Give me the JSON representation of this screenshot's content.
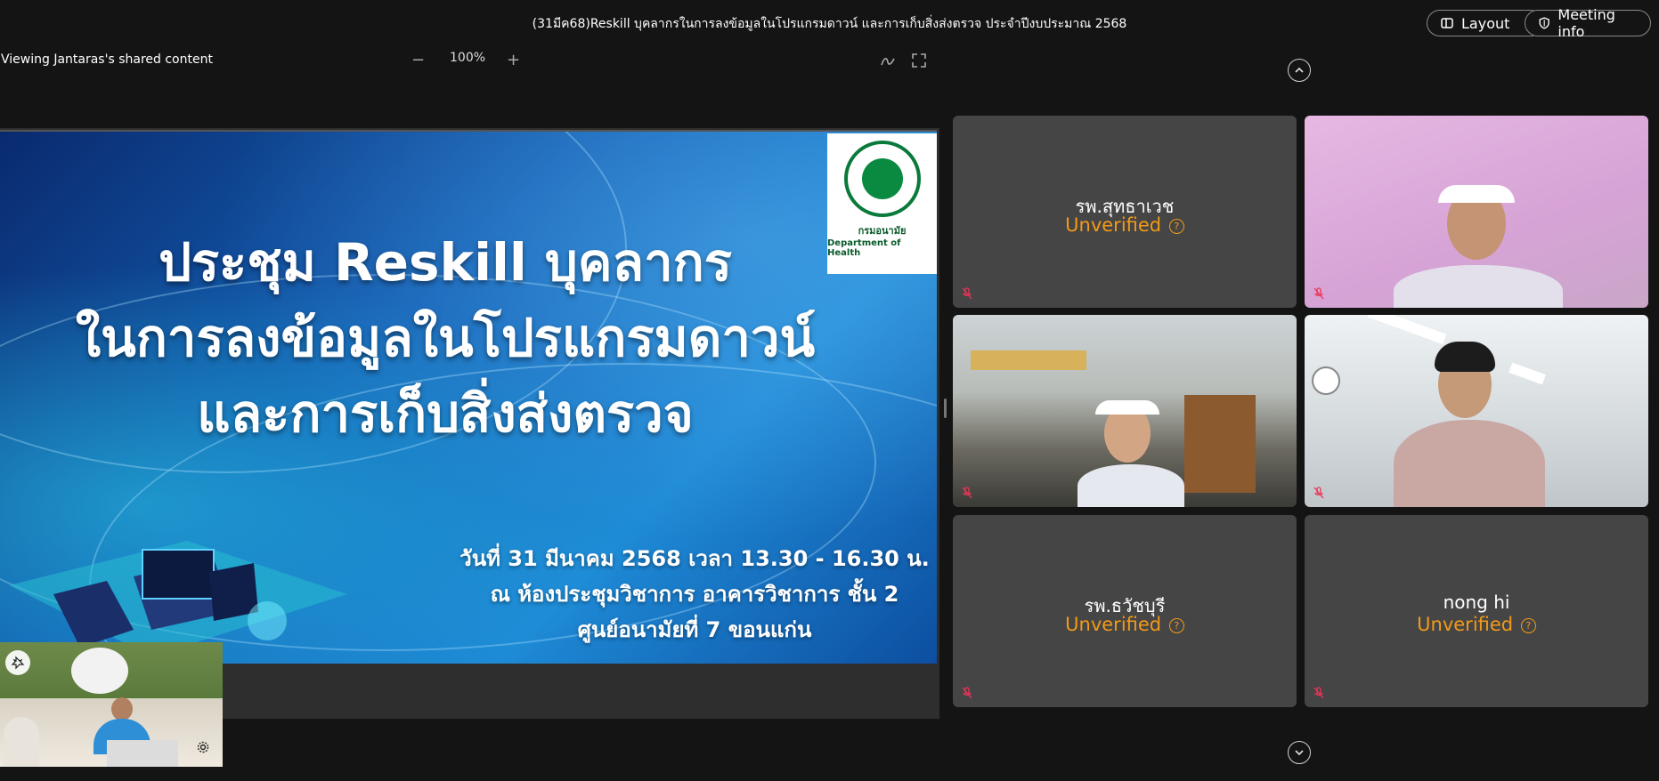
{
  "header": {
    "meeting_title": "(31มีค68)Reskill บุคลากรในการลงข้อมูลในโปรแกรมดาวน์ และการเก็บสิ่งส่งตรวจ ประจำปีงบประมาณ 2568",
    "layout_label": "Layout",
    "meeting_info_label": "Meeting info"
  },
  "share": {
    "viewing_label": "Viewing Jantaras's shared content",
    "zoom_minus": "−",
    "zoom_level": "100%",
    "zoom_plus": "+"
  },
  "slide": {
    "title_line1": "ประชุม Reskill บุคลากร",
    "title_line2": "ในการลงข้อมูลในโปรแกรมดาวน์",
    "title_line3": "และการเก็บสิ่งส่งตรวจ",
    "info_line1": "วันที่ 31 มีนาคม 2568 เวลา 13.30 - 16.30 น.",
    "info_line2": "ณ ห้องประชุมวิชาการ อาคารวิชาการ ชั้น 2",
    "info_line3": "ศูนย์อนามัยที่ 7 ขอนแก่น",
    "logo_th": "กรมอนามัย",
    "logo_en": "Department of Health"
  },
  "participants": [
    {
      "name": "รพ.สุทธาเวช",
      "status": "Unverified",
      "video": false
    },
    {
      "name": "",
      "status": "",
      "video": true
    },
    {
      "name": "",
      "status": "",
      "video": true
    },
    {
      "name": "",
      "status": "",
      "video": true
    },
    {
      "name": "รพ.ธวัชบุรี",
      "status": "Unverified",
      "video": false
    },
    {
      "name": "nong hi",
      "status": "Unverified",
      "video": false
    }
  ],
  "colors": {
    "background": "#141414",
    "tile": "#454545",
    "unverified": "#f29a18"
  },
  "icons": [
    "layout-icon",
    "shield-icon",
    "pen-icon",
    "fullscreen-icon",
    "chevron-up-icon",
    "chevron-down-icon",
    "mic-off-icon",
    "pin-icon",
    "gear-icon"
  ]
}
